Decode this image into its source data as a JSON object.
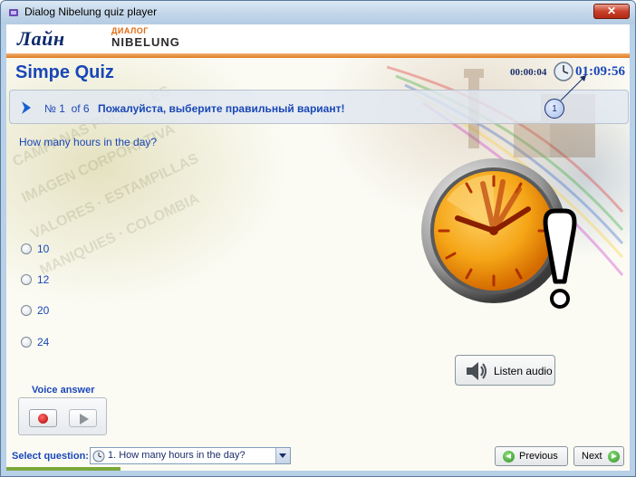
{
  "window": {
    "title": "Dialog Nibelung quiz player",
    "close_glyph": "✕"
  },
  "brand": {
    "logo_main": "Лайн",
    "logo_sub": "ДИАЛОГ",
    "logo_nibelung": "NIBELUNG"
  },
  "quiz": {
    "title": "Simpe Quiz",
    "elapsed_time": "00:00:04",
    "remaining_time": "01:09:56",
    "callout_number": "1"
  },
  "question_bar": {
    "number_label": "№ 1",
    "of_label": "of 6",
    "instruction": "Пожалуйста, выберите правильный вариант!"
  },
  "question": {
    "text": "How many hours in the day?"
  },
  "answers": [
    {
      "label": "10",
      "selected": false
    },
    {
      "label": "12",
      "selected": false
    },
    {
      "label": "20",
      "selected": false
    },
    {
      "label": "24",
      "selected": false
    }
  ],
  "audio": {
    "listen_label": "Listen audio"
  },
  "voice": {
    "label": "Voice answer"
  },
  "footer": {
    "select_label": "Select question:",
    "selected_question": "1. How many hours in the day?",
    "previous_label": "Previous",
    "next_label": "Next"
  },
  "colors": {
    "accent": "#1a47b8",
    "brand_orange": "#e07a20",
    "clock_orange": "#f5a516"
  }
}
